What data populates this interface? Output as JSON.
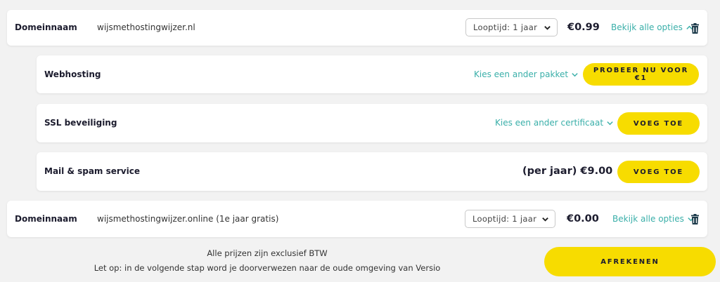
{
  "domain_row_1": {
    "label": "Domeinnaam",
    "domain": "wijsmethostingwijzer.nl",
    "term_select": "Looptijd: 1 jaar",
    "price": "€0.99",
    "options_link": "Bekijk alle opties",
    "options_state": "expanded"
  },
  "webhosting": {
    "label": "Webhosting",
    "link": "Kies een ander pakket",
    "button": "PROBEER NU VOOR €1"
  },
  "ssl": {
    "label": "SSL beveiliging",
    "link": "Kies een ander certificaat",
    "button": "VOEG TOE"
  },
  "mail": {
    "label": "Mail & spam service",
    "price": "(per jaar) €9.00",
    "button": "VOEG TOE"
  },
  "domain_row_2": {
    "label": "Domeinnaam",
    "domain": "wijsmethostingwijzer.online (1e jaar gratis)",
    "term_select": "Looptijd: 1 jaar",
    "price": "€0.00",
    "options_link": "Bekijk alle opties",
    "options_state": "collapsed"
  },
  "footer": {
    "note_1": "Alle prijzen zijn exclusief BTW",
    "note_2": "Let op: in de volgende stap word je doorverwezen naar de oude omgeving van Versio",
    "checkout_button": "AFREKENEN"
  },
  "colors": {
    "accent_yellow": "#f7dc00",
    "link_teal": "#3aafa9",
    "text_dark": "#1c1c2e",
    "background": "#f2f2f2"
  }
}
